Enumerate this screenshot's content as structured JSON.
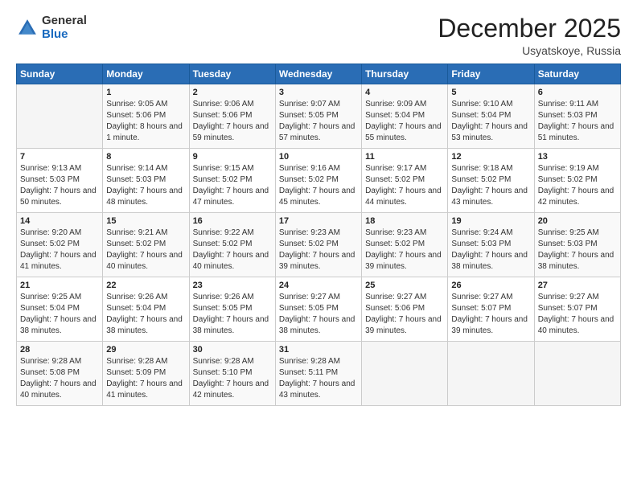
{
  "logo": {
    "general": "General",
    "blue": "Blue"
  },
  "title": "December 2025",
  "location": "Usyatskoye, Russia",
  "days_header": [
    "Sunday",
    "Monday",
    "Tuesday",
    "Wednesday",
    "Thursday",
    "Friday",
    "Saturday"
  ],
  "weeks": [
    [
      {
        "day": "",
        "sunrise": "",
        "sunset": "",
        "daylight": ""
      },
      {
        "day": "1",
        "sunrise": "Sunrise: 9:05 AM",
        "sunset": "Sunset: 5:06 PM",
        "daylight": "Daylight: 8 hours and 1 minute."
      },
      {
        "day": "2",
        "sunrise": "Sunrise: 9:06 AM",
        "sunset": "Sunset: 5:06 PM",
        "daylight": "Daylight: 7 hours and 59 minutes."
      },
      {
        "day": "3",
        "sunrise": "Sunrise: 9:07 AM",
        "sunset": "Sunset: 5:05 PM",
        "daylight": "Daylight: 7 hours and 57 minutes."
      },
      {
        "day": "4",
        "sunrise": "Sunrise: 9:09 AM",
        "sunset": "Sunset: 5:04 PM",
        "daylight": "Daylight: 7 hours and 55 minutes."
      },
      {
        "day": "5",
        "sunrise": "Sunrise: 9:10 AM",
        "sunset": "Sunset: 5:04 PM",
        "daylight": "Daylight: 7 hours and 53 minutes."
      },
      {
        "day": "6",
        "sunrise": "Sunrise: 9:11 AM",
        "sunset": "Sunset: 5:03 PM",
        "daylight": "Daylight: 7 hours and 51 minutes."
      }
    ],
    [
      {
        "day": "7",
        "sunrise": "Sunrise: 9:13 AM",
        "sunset": "Sunset: 5:03 PM",
        "daylight": "Daylight: 7 hours and 50 minutes."
      },
      {
        "day": "8",
        "sunrise": "Sunrise: 9:14 AM",
        "sunset": "Sunset: 5:03 PM",
        "daylight": "Daylight: 7 hours and 48 minutes."
      },
      {
        "day": "9",
        "sunrise": "Sunrise: 9:15 AM",
        "sunset": "Sunset: 5:02 PM",
        "daylight": "Daylight: 7 hours and 47 minutes."
      },
      {
        "day": "10",
        "sunrise": "Sunrise: 9:16 AM",
        "sunset": "Sunset: 5:02 PM",
        "daylight": "Daylight: 7 hours and 45 minutes."
      },
      {
        "day": "11",
        "sunrise": "Sunrise: 9:17 AM",
        "sunset": "Sunset: 5:02 PM",
        "daylight": "Daylight: 7 hours and 44 minutes."
      },
      {
        "day": "12",
        "sunrise": "Sunrise: 9:18 AM",
        "sunset": "Sunset: 5:02 PM",
        "daylight": "Daylight: 7 hours and 43 minutes."
      },
      {
        "day": "13",
        "sunrise": "Sunrise: 9:19 AM",
        "sunset": "Sunset: 5:02 PM",
        "daylight": "Daylight: 7 hours and 42 minutes."
      }
    ],
    [
      {
        "day": "14",
        "sunrise": "Sunrise: 9:20 AM",
        "sunset": "Sunset: 5:02 PM",
        "daylight": "Daylight: 7 hours and 41 minutes."
      },
      {
        "day": "15",
        "sunrise": "Sunrise: 9:21 AM",
        "sunset": "Sunset: 5:02 PM",
        "daylight": "Daylight: 7 hours and 40 minutes."
      },
      {
        "day": "16",
        "sunrise": "Sunrise: 9:22 AM",
        "sunset": "Sunset: 5:02 PM",
        "daylight": "Daylight: 7 hours and 40 minutes."
      },
      {
        "day": "17",
        "sunrise": "Sunrise: 9:23 AM",
        "sunset": "Sunset: 5:02 PM",
        "daylight": "Daylight: 7 hours and 39 minutes."
      },
      {
        "day": "18",
        "sunrise": "Sunrise: 9:23 AM",
        "sunset": "Sunset: 5:02 PM",
        "daylight": "Daylight: 7 hours and 39 minutes."
      },
      {
        "day": "19",
        "sunrise": "Sunrise: 9:24 AM",
        "sunset": "Sunset: 5:03 PM",
        "daylight": "Daylight: 7 hours and 38 minutes."
      },
      {
        "day": "20",
        "sunrise": "Sunrise: 9:25 AM",
        "sunset": "Sunset: 5:03 PM",
        "daylight": "Daylight: 7 hours and 38 minutes."
      }
    ],
    [
      {
        "day": "21",
        "sunrise": "Sunrise: 9:25 AM",
        "sunset": "Sunset: 5:04 PM",
        "daylight": "Daylight: 7 hours and 38 minutes."
      },
      {
        "day": "22",
        "sunrise": "Sunrise: 9:26 AM",
        "sunset": "Sunset: 5:04 PM",
        "daylight": "Daylight: 7 hours and 38 minutes."
      },
      {
        "day": "23",
        "sunrise": "Sunrise: 9:26 AM",
        "sunset": "Sunset: 5:05 PM",
        "daylight": "Daylight: 7 hours and 38 minutes."
      },
      {
        "day": "24",
        "sunrise": "Sunrise: 9:27 AM",
        "sunset": "Sunset: 5:05 PM",
        "daylight": "Daylight: 7 hours and 38 minutes."
      },
      {
        "day": "25",
        "sunrise": "Sunrise: 9:27 AM",
        "sunset": "Sunset: 5:06 PM",
        "daylight": "Daylight: 7 hours and 39 minutes."
      },
      {
        "day": "26",
        "sunrise": "Sunrise: 9:27 AM",
        "sunset": "Sunset: 5:07 PM",
        "daylight": "Daylight: 7 hours and 39 minutes."
      },
      {
        "day": "27",
        "sunrise": "Sunrise: 9:27 AM",
        "sunset": "Sunset: 5:07 PM",
        "daylight": "Daylight: 7 hours and 40 minutes."
      }
    ],
    [
      {
        "day": "28",
        "sunrise": "Sunrise: 9:28 AM",
        "sunset": "Sunset: 5:08 PM",
        "daylight": "Daylight: 7 hours and 40 minutes."
      },
      {
        "day": "29",
        "sunrise": "Sunrise: 9:28 AM",
        "sunset": "Sunset: 5:09 PM",
        "daylight": "Daylight: 7 hours and 41 minutes."
      },
      {
        "day": "30",
        "sunrise": "Sunrise: 9:28 AM",
        "sunset": "Sunset: 5:10 PM",
        "daylight": "Daylight: 7 hours and 42 minutes."
      },
      {
        "day": "31",
        "sunrise": "Sunrise: 9:28 AM",
        "sunset": "Sunset: 5:11 PM",
        "daylight": "Daylight: 7 hours and 43 minutes."
      },
      {
        "day": "",
        "sunrise": "",
        "sunset": "",
        "daylight": ""
      },
      {
        "day": "",
        "sunrise": "",
        "sunset": "",
        "daylight": ""
      },
      {
        "day": "",
        "sunrise": "",
        "sunset": "",
        "daylight": ""
      }
    ]
  ]
}
